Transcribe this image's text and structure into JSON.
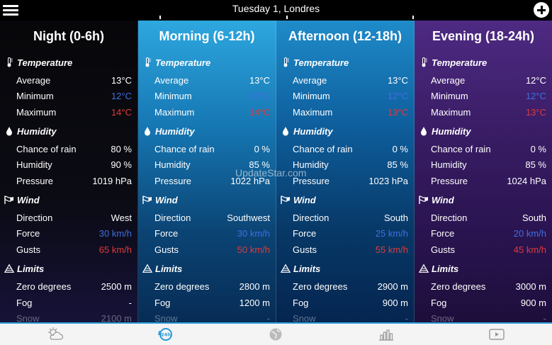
{
  "header": {
    "date_title": "Tuesday 1, Londres",
    "menu_icon": "hamburger-menu-icon",
    "add_icon": "add-location-icon"
  },
  "sections": {
    "temperature": "Temperature",
    "humidity": "Humidity",
    "wind": "Wind",
    "limits": "Limits"
  },
  "labels": {
    "average": "Average",
    "minimum": "Minimum",
    "maximum": "Maximum",
    "chance_of_rain": "Chance of rain",
    "humidity": "Humidity",
    "pressure": "Pressure",
    "direction": "Direction",
    "force": "Force",
    "gusts": "Gusts",
    "zero_degrees": "Zero degrees",
    "fog": "Fog",
    "snow": "Snow"
  },
  "periods": [
    {
      "title": "Night (0-6h)",
      "average": "13°C",
      "minimum": "12°C",
      "maximum": "14°C",
      "chance_of_rain": "80 %",
      "humidity": "90 %",
      "pressure": "1019 hPa",
      "direction": "West",
      "force": "30 km/h",
      "gusts": "65 km/h",
      "zero_degrees": "2500 m",
      "fog": "-",
      "snow": "2100 m"
    },
    {
      "title": "Morning (6-12h)",
      "average": "13°C",
      "minimum": "12°C",
      "maximum": "14°C",
      "chance_of_rain": "0 %",
      "humidity": "85 %",
      "pressure": "1022 hPa",
      "direction": "Southwest",
      "force": "30 km/h",
      "gusts": "50 km/h",
      "zero_degrees": "2800 m",
      "fog": "1200 m",
      "snow": "-"
    },
    {
      "title": "Afternoon (12-18h)",
      "average": "13°C",
      "minimum": "12°C",
      "maximum": "13°C",
      "chance_of_rain": "0 %",
      "humidity": "85 %",
      "pressure": "1023 hPa",
      "direction": "South",
      "force": "25 km/h",
      "gusts": "55 km/h",
      "zero_degrees": "2900 m",
      "fog": "900 m",
      "snow": "-"
    },
    {
      "title": "Evening (18-24h)",
      "average": "12°C",
      "minimum": "12°C",
      "maximum": "13°C",
      "chance_of_rain": "0 %",
      "humidity": "85 %",
      "pressure": "1024 hPa",
      "direction": "South",
      "force": "20 km/h",
      "gusts": "45 km/h",
      "zero_degrees": "3000 m",
      "fog": "900 m",
      "snow": "-"
    }
  ],
  "watermark": "UpdateStar.com",
  "bottom_tabs": [
    {
      "icon": "weather-forecast-icon",
      "active": false
    },
    {
      "icon": "hourly-detail-icon",
      "active": true
    },
    {
      "icon": "map-globe-icon",
      "active": false
    },
    {
      "icon": "charts-icon",
      "active": false
    },
    {
      "icon": "video-icon",
      "active": false
    }
  ],
  "colors": {
    "accent": "#35a2dc",
    "min_temp": "#3f6fe0",
    "max_temp": "#e03a3a",
    "night": "#07070a",
    "morning": "#2ea7df",
    "afternoon": "#1f8bc9",
    "evening": "#4e2a83"
  }
}
